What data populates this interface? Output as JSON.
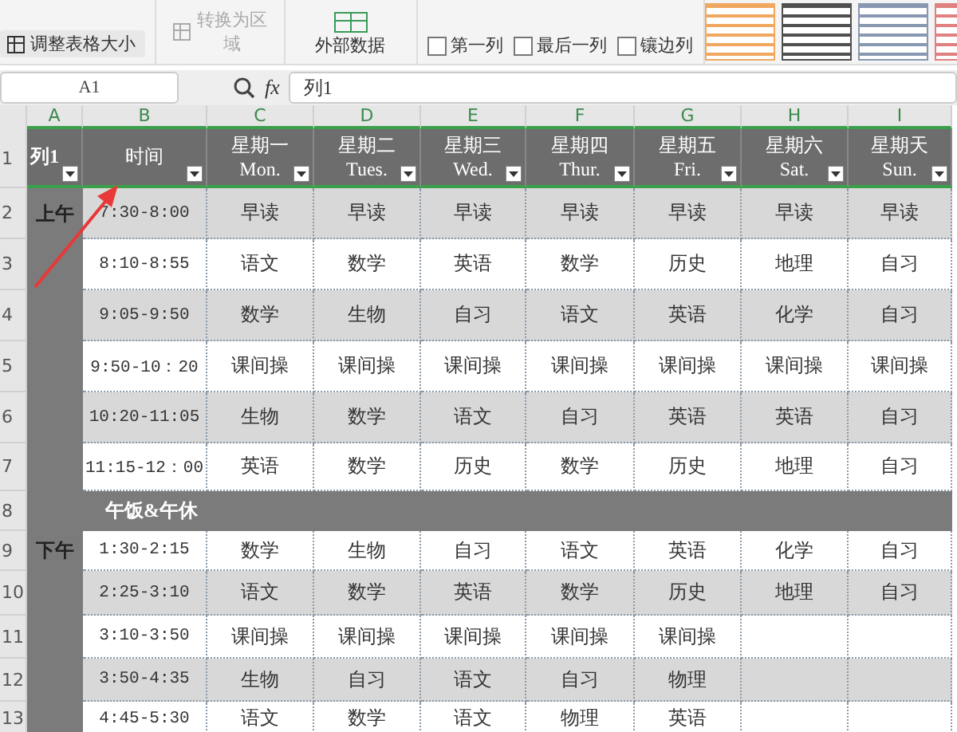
{
  "ribbon": {
    "buttons": [
      {
        "label": "调整表格大小",
        "disabled": false
      },
      {
        "label": "转换为区域",
        "disabled": true
      }
    ],
    "external_data": {
      "label": "外部数据"
    },
    "checkboxes": [
      {
        "label": "第一列",
        "checked": false
      },
      {
        "label": "最后一列",
        "checked": false
      },
      {
        "label": "镶边列",
        "checked": false
      }
    ],
    "style_gallery": [
      {
        "color": "#f0a860"
      },
      {
        "color": "#505050"
      },
      {
        "color": "#8898b0"
      },
      {
        "color": "#e08080"
      }
    ]
  },
  "formula_bar": {
    "name_box": "A1",
    "function_label": "fx",
    "formula": "列1"
  },
  "sheet": {
    "columns": [
      "A",
      "B",
      "C",
      "D",
      "E",
      "F",
      "G",
      "H",
      "I"
    ],
    "header_row": {
      "number": "1",
      "cells": [
        {
          "lines": [
            "列1"
          ]
        },
        {
          "lines": [
            "时间"
          ]
        },
        {
          "lines": [
            "星期一",
            "Mon."
          ]
        },
        {
          "lines": [
            "星期二",
            "Tues."
          ]
        },
        {
          "lines": [
            "星期三",
            "Wed."
          ]
        },
        {
          "lines": [
            "星期四",
            "Thur."
          ]
        },
        {
          "lines": [
            "星期五",
            "Fri."
          ]
        },
        {
          "lines": [
            "星期六",
            "Sat."
          ]
        },
        {
          "lines": [
            "星期天",
            "Sun."
          ]
        }
      ]
    },
    "rows": [
      {
        "kind": "lesson",
        "number": "2",
        "banded": true,
        "section": "上午",
        "time": "7:30-8:00",
        "cells": [
          "早读",
          "早读",
          "早读",
          "早读",
          "早读",
          "早读",
          "早读"
        ]
      },
      {
        "kind": "lesson",
        "number": "3",
        "banded": false,
        "time": "8:10-8:55",
        "cells": [
          "语文",
          "数学",
          "英语",
          "数学",
          "历史",
          "地理",
          "自习"
        ]
      },
      {
        "kind": "lesson",
        "number": "4",
        "banded": true,
        "time": "9:05-9:50",
        "cells": [
          "数学",
          "生物",
          "自习",
          "语文",
          "英语",
          "化学",
          "自习"
        ]
      },
      {
        "kind": "lesson",
        "number": "5",
        "banded": false,
        "time": "9:50-10：20",
        "cells": [
          "课间操",
          "课间操",
          "课间操",
          "课间操",
          "课间操",
          "课间操",
          "课间操"
        ]
      },
      {
        "kind": "lesson",
        "number": "6",
        "banded": true,
        "time": "10:20-11:05",
        "cells": [
          "生物",
          "数学",
          "语文",
          "自习",
          "英语",
          "英语",
          "自习"
        ]
      },
      {
        "kind": "lesson",
        "number": "7",
        "banded": false,
        "time": "11:15-12：00",
        "cells": [
          "英语",
          "数学",
          "历史",
          "数学",
          "历史",
          "地理",
          "自习"
        ]
      },
      {
        "kind": "break",
        "number": "8",
        "label": "午饭&午休"
      },
      {
        "kind": "lesson",
        "number": "9",
        "banded": false,
        "section": "下午",
        "time": "1:30-2:15",
        "cells": [
          "数学",
          "生物",
          "自习",
          "语文",
          "英语",
          "化学",
          "自习"
        ]
      },
      {
        "kind": "lesson",
        "number": "10",
        "banded": true,
        "time": "2:25-3:10",
        "cells": [
          "语文",
          "数学",
          "英语",
          "数学",
          "历史",
          "地理",
          "自习"
        ]
      },
      {
        "kind": "lesson",
        "number": "11",
        "banded": false,
        "time": "3:10-3:50",
        "cells": [
          "课间操",
          "课间操",
          "课间操",
          "课间操",
          "课间操"
        ]
      },
      {
        "kind": "lesson",
        "number": "12",
        "banded": true,
        "time": "3:50-4:35",
        "cells": [
          "生物",
          "自习",
          "语文",
          "自习",
          "物理"
        ]
      },
      {
        "kind": "lesson",
        "number": "13",
        "banded": false,
        "time": "4:45-5:30",
        "cells": [
          "语文",
          "数学",
          "语文",
          "物理",
          "英语"
        ]
      }
    ]
  }
}
